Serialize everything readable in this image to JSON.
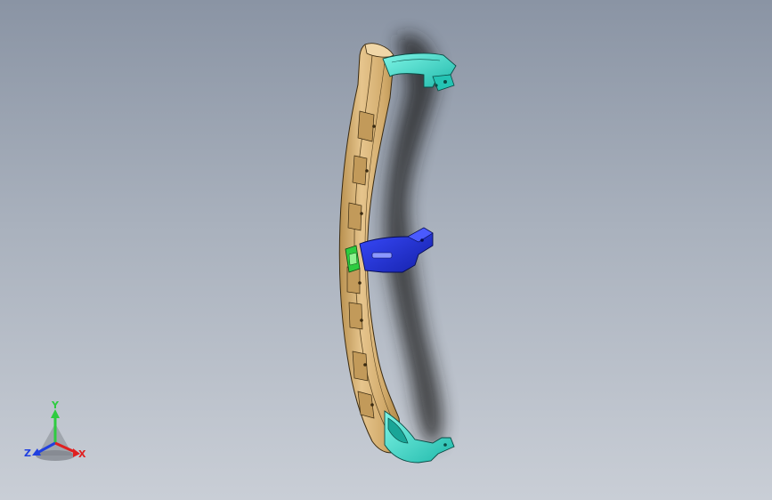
{
  "viewport": {
    "background_top": "#8a94a4",
    "background_bottom": "#c9ced6"
  },
  "model": {
    "beam_color": "#d8b47a",
    "end_bracket_color": "#40e0d0",
    "center_bracket_color": "#1f2fd6",
    "clip_color": "#2ecc40",
    "edge_color": "#3a2a10"
  },
  "triad": {
    "y_label": "Y",
    "z_label": "Z",
    "x_label": "X",
    "y_color": "#2ecc40",
    "z_color": "#2040e0",
    "x_color": "#e02020"
  }
}
